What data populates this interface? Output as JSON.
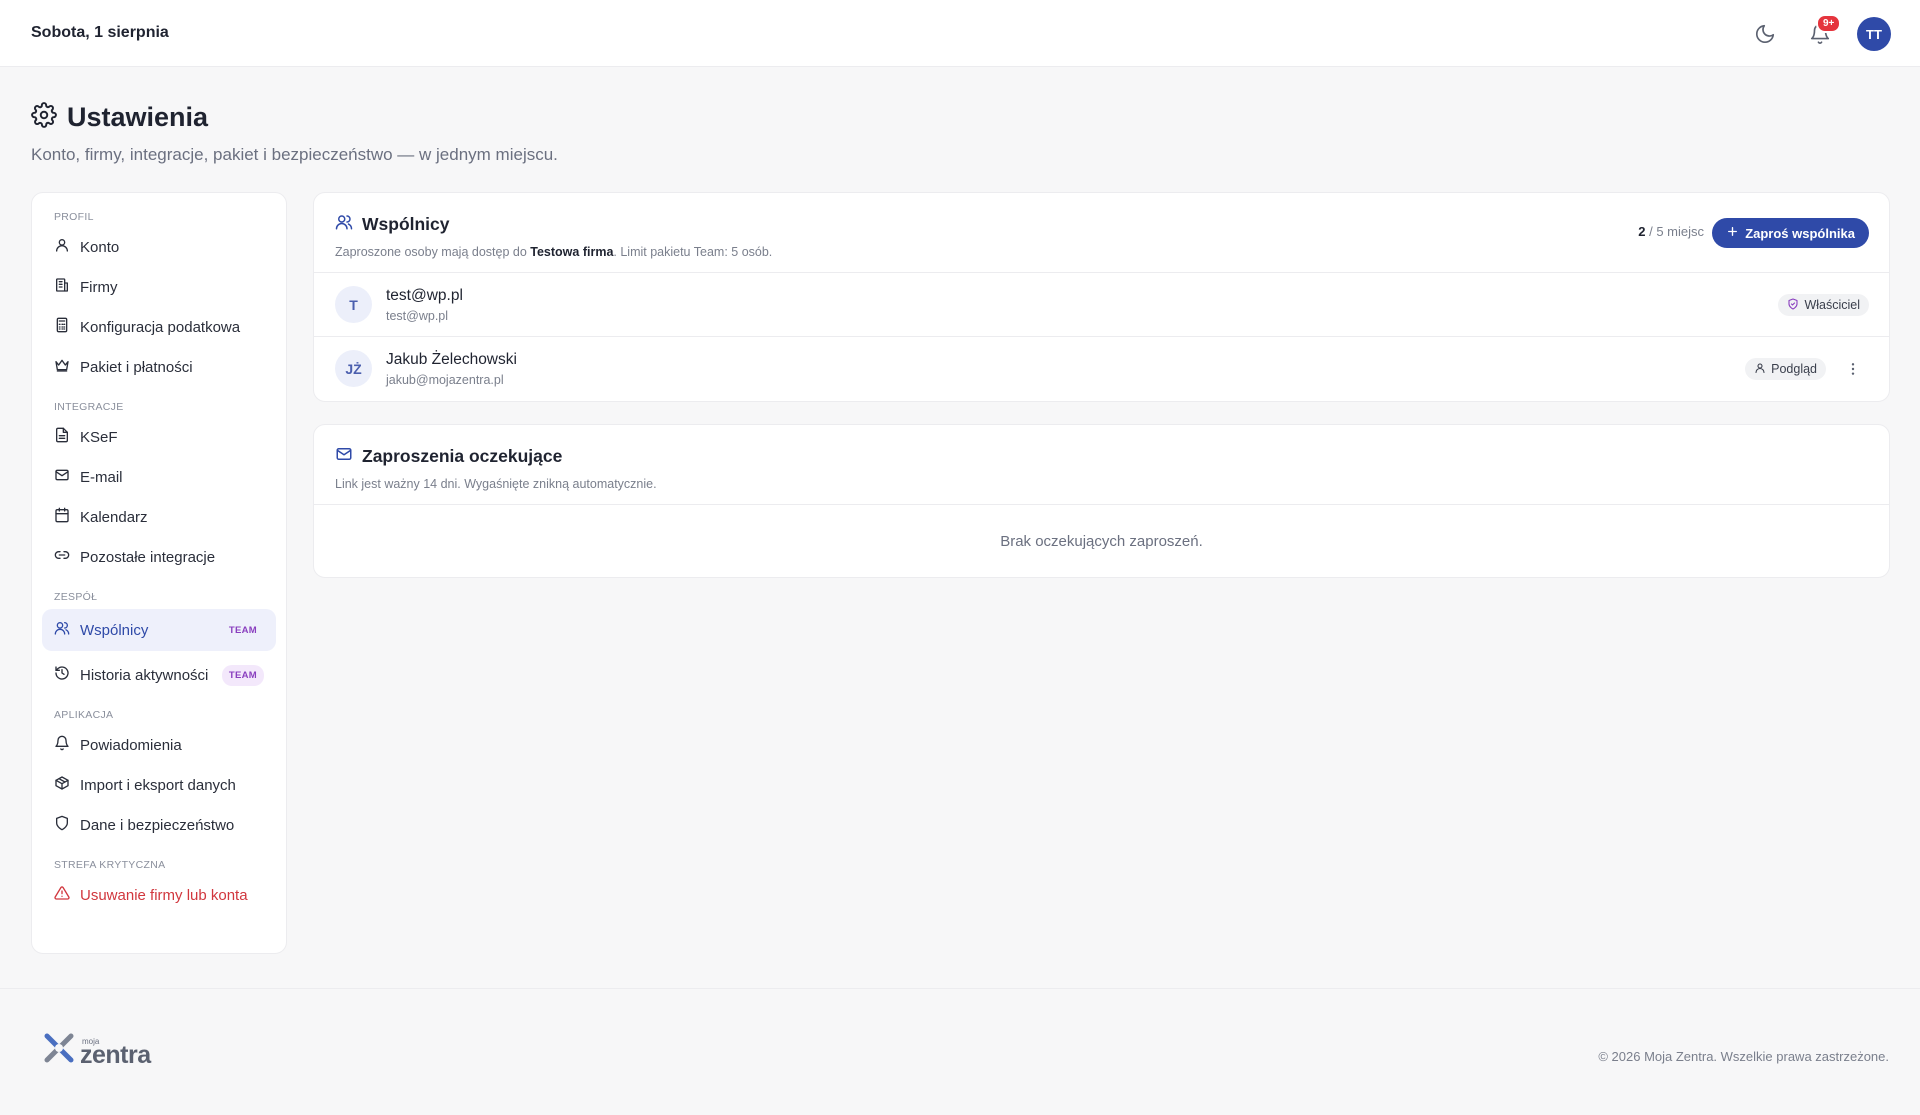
{
  "topbar": {
    "date": "Sobota, 1 sierpnia",
    "notifications_badge": "9+",
    "user_initials": "TT"
  },
  "page": {
    "title": "Ustawienia",
    "subtitle": "Konto, firmy, integracje, pakiet i bezpieczeństwo — w jednym miejscu."
  },
  "sidebar": {
    "sections": {
      "profil": "PROFIL",
      "integracje": "INTEGRACJE",
      "zespol": "ZESPÓŁ",
      "aplikacja": "APLIKACJA",
      "strefa": "STREFA KRYTYCZNA"
    },
    "items": {
      "konto": "Konto",
      "firmy": "Firmy",
      "konfiguracja": "Konfiguracja podatkowa",
      "pakiet": "Pakiet i płatności",
      "ksef": "KSeF",
      "email": "E-mail",
      "kalendarz": "Kalendarz",
      "pozostale": "Pozostałe integracje",
      "wspolnicy": "Wspólnicy",
      "historia": "Historia aktywności",
      "powiadomienia": "Powiadomienia",
      "import": "Import i eksport danych",
      "dane": "Dane i bezpieczeństwo",
      "usuwanie": "Usuwanie firmy lub konta"
    },
    "team_badge": "TEAM"
  },
  "partners": {
    "title": "Wspólnicy",
    "desc_prefix": "Zaproszone osoby mają dostęp do ",
    "company": "Testowa firma",
    "desc_suffix": ". Limit pakietu Team: 5 osób.",
    "seats_used": "2",
    "seats_rest": " / 5 miejsc",
    "invite_button": "Zaproś wspólnika",
    "members": [
      {
        "initials": "T",
        "name": "test@wp.pl",
        "email": "test@wp.pl",
        "role": "Właściciel"
      },
      {
        "initials": "JŻ",
        "name": "Jakub Żelechowski",
        "email": "jakub@mojazentra.pl",
        "role": "Podgląd"
      }
    ]
  },
  "pending": {
    "title": "Zaproszenia oczekujące",
    "desc": "Link jest ważny 14 dni. Wygaśnięte znikną automatycznie.",
    "empty": "Brak oczekujących zaproszeń."
  },
  "footer": {
    "logo_small": "moja",
    "logo_main": "zentra",
    "copyright": "© 2026 Moja Zentra. Wszelkie prawa zastrzeżone."
  },
  "colors": {
    "accent": "#2f4aa8",
    "danger": "#d1373e",
    "team_badge": "#8a3fbf"
  }
}
